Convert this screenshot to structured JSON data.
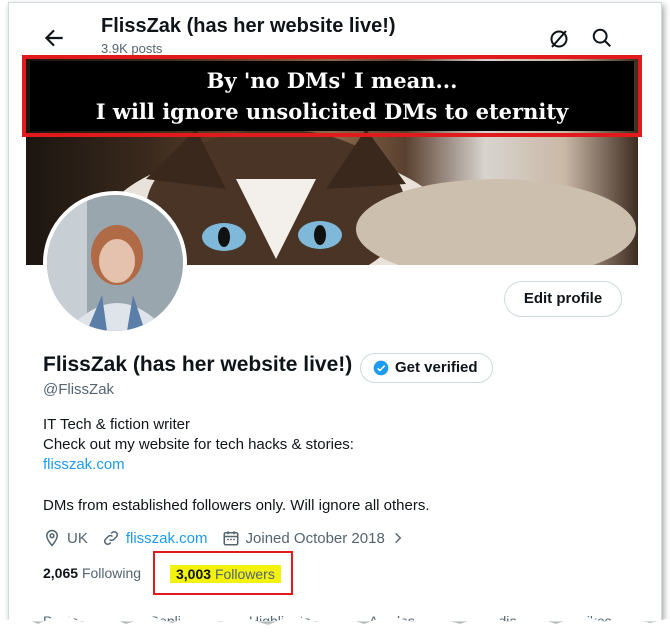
{
  "header": {
    "title": "FlissZak (has her website live!)",
    "subtitle": "3.9K posts"
  },
  "banner": {
    "line1": "By 'no DMs' I mean...",
    "line2": "I will ignore unsolicited DMs to eternity"
  },
  "profile": {
    "edit_label": "Edit profile",
    "display_name": "FlissZak (has her website live!)",
    "verify_label": "Get verified",
    "handle": "@FlissZak",
    "bio_line1": "IT Tech & fiction writer",
    "bio_line2": "Check out my website for tech hacks & stories:",
    "bio_link": "flisszak.com",
    "bio_line3": "DMs from established followers only. Will ignore all others.",
    "location": "UK",
    "website": "flisszak.com",
    "joined": "Joined October 2018",
    "following_count": "2,065",
    "following_label": "Following",
    "followers_count": "3,003",
    "followers_label": "Followers"
  },
  "tabs": [
    "Posts",
    "Replies",
    "Highlights",
    "Articles",
    "Media",
    "Likes"
  ],
  "colors": {
    "accent": "#1d9bf0",
    "highlight": "#f2f20c",
    "annotation": "#e11b1b"
  }
}
